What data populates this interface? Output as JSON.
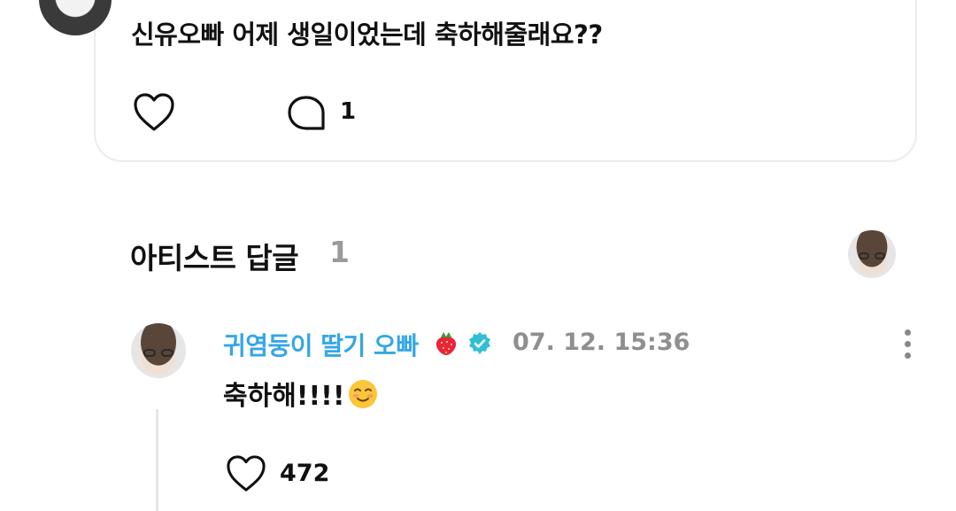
{
  "post": {
    "text": "신유오빠 어제 생일이었는데 축하해줄래요??",
    "comment_count": "1",
    "icons": {
      "like": "heart-outline-icon",
      "comment": "speech-bubble-icon"
    }
  },
  "artist_replies": {
    "title": "아티스트 답글",
    "count": "1"
  },
  "reply": {
    "author": "귀염둥이 딸기 오빠",
    "author_emoji": "strawberry-icon",
    "verified": "verified-badge-icon",
    "timestamp": "07. 12. 15:36",
    "text": "축하해!!!!",
    "text_emoji": "smiling-face-icon",
    "like_count": "472"
  },
  "colors": {
    "author_name": "#35a7e6",
    "verified_badge": "#2fc0d6",
    "timestamp": "#8f8f8f",
    "count_gray": "#9a9a9a",
    "card_border": "#ececec"
  }
}
